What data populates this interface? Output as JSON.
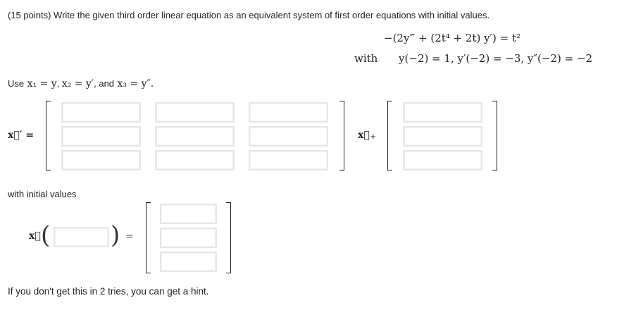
{
  "problem": {
    "header": "(15 points) Write the given third order linear equation as an equivalent system of first order equations with initial values.",
    "with_label": "with",
    "equation": "−(2y‴ + (2t⁴ + 2t) y′) = t²",
    "initial_conditions": "y(−2) = 1,  y′(−2) = −3,  y″(−2) = −2"
  },
  "substitution": {
    "use": "Use",
    "x1": "x₁ = y",
    "x2": "x₂ = y′",
    "and": "and",
    "x3": "x₃ = y″."
  },
  "system": {
    "lhs": "x⃗′ =",
    "vector_symbol": "x⃗",
    "plus": "+"
  },
  "initial_values": {
    "label": "with initial values",
    "equals": "="
  },
  "footer": {
    "hint": "If you don't get this in 2 tries, you can get a hint."
  }
}
